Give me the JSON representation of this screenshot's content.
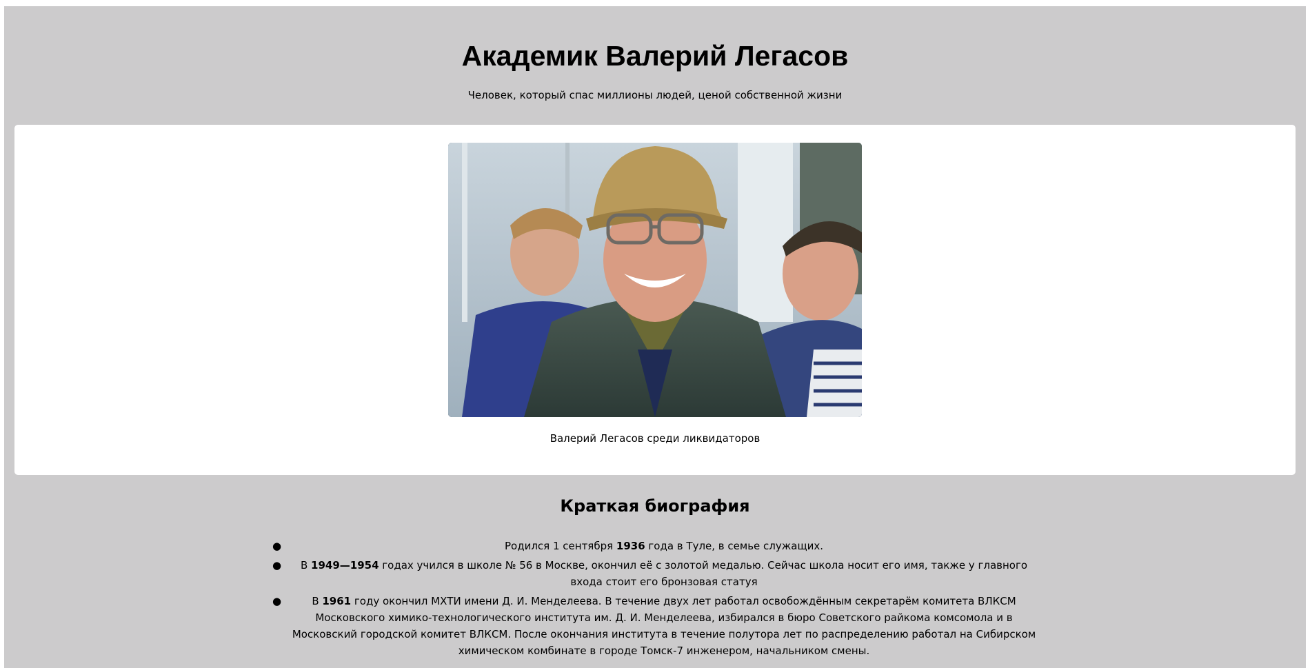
{
  "header": {
    "title": "Академик Валерий Легасов",
    "subtitle": "Человек, который спас миллионы людей, ценой собственной жизни"
  },
  "photo": {
    "caption": "Валерий Легасов среди ликвидаторов"
  },
  "biography": {
    "heading": "Краткая биография",
    "items": [
      {
        "a": "Родился 1 сентября ",
        "b": "1936",
        "c": " года в Туле, в семье служащих."
      },
      {
        "a": "В ",
        "b": "1949—1954",
        "c": " годах учился в школе № 56 в Москве, окончил её с золотой медалью. Сейчас школа носит его имя, также у главного входа стоит его бронзовая статуя"
      },
      {
        "a": "В ",
        "b": "1961",
        "c": " году окончил МХТИ имени Д. И. Менделеева. В течение двух лет работал освобождённым секретарём комитета ВЛКСМ Московского химико-технологического института им. Д. И. Менделеева, избирался в бюро Советского райкома комсомола и в Московский городской комитет ВЛКСМ. После окончания института в течение полутора лет по распределению работал на Сибирском химическом комбинате в городе Томск-7 инженером, начальником смены."
      }
    ]
  }
}
